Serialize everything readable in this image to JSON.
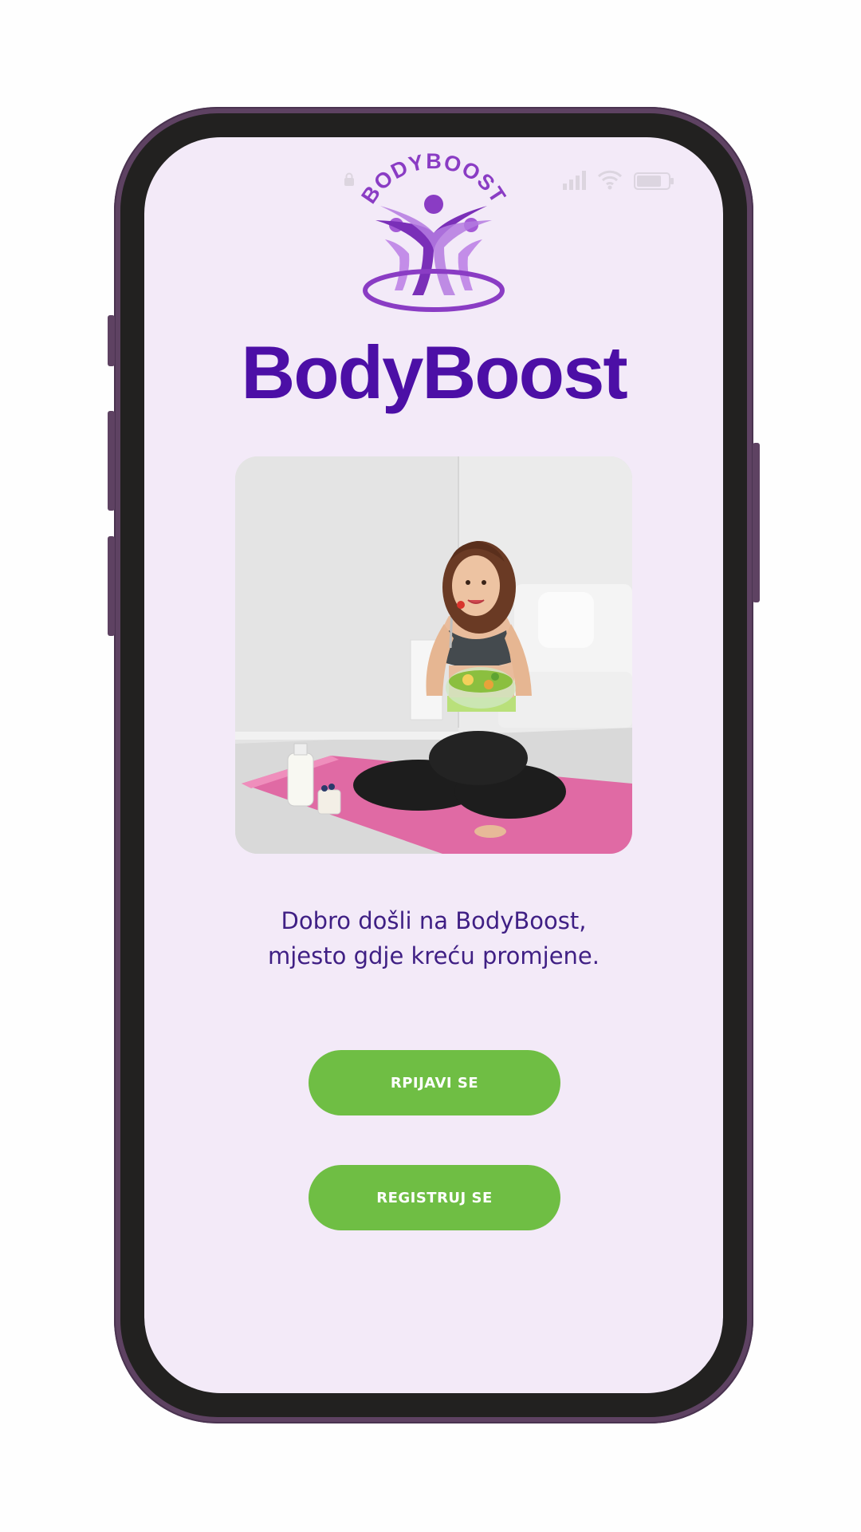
{
  "app": {
    "logo_text": "BODYBOOST",
    "title": "BodyBoost"
  },
  "welcome": {
    "line1": "Dobro došli na BodyBoost,",
    "line2": "mjesto gdje kreću promjene."
  },
  "buttons": {
    "login_label": "RPIJAVI SE",
    "register_label": "REGISTRUJ SE"
  },
  "hero_image": {
    "subject": "woman-eating-salad-on-yoga-mat"
  },
  "icons": {
    "lock": "lock-icon",
    "signal": "signal-icon",
    "wifi": "wifi-icon",
    "battery": "battery-icon",
    "logo": "bodyboost-logo"
  },
  "colors": {
    "background": "#f3eaf8",
    "title": "#4c0fa6",
    "text": "#3f1f84",
    "button": "#6fbe44",
    "logo_purple": "#8a3cc4",
    "phone_frame": "#5e4262"
  }
}
